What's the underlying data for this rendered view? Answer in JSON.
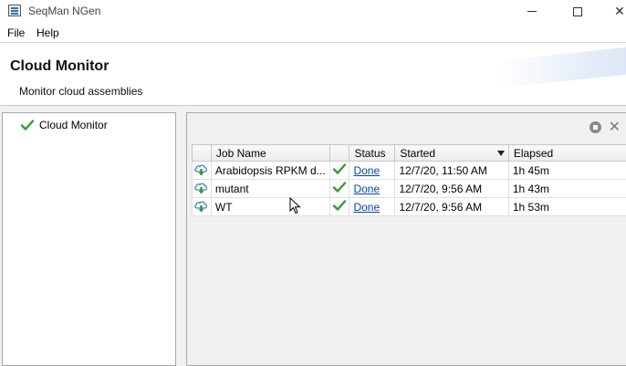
{
  "window": {
    "title": "SeqMan NGen",
    "minimize_icon": "minimize-icon",
    "maximize_icon": "maximize-icon",
    "close_icon": "close-icon",
    "close_glyph": "✕"
  },
  "menu": {
    "items": [
      {
        "label": "File"
      },
      {
        "label": "Help"
      }
    ]
  },
  "header": {
    "title": "Cloud Monitor",
    "subtitle": "Monitor cloud assemblies"
  },
  "sidebar": {
    "items": [
      {
        "label": "Cloud Monitor",
        "icon": "check-icon"
      }
    ]
  },
  "panel": {
    "tools": [
      {
        "icon": "stop-icon"
      },
      {
        "icon": "close-icon",
        "glyph": "✕"
      }
    ]
  },
  "table": {
    "columns": [
      "",
      "Job Name",
      "",
      "Status",
      "Started",
      "Elapsed"
    ],
    "sorted_column": "Started",
    "sort_direction": "descending",
    "rows": [
      {
        "icon": "cloud-download-icon",
        "job_name": "Arabidopsis RPKM d...",
        "done_icon": "check-icon",
        "status": "Done",
        "started": "12/7/20, 11:50 AM",
        "elapsed": "1h 45m"
      },
      {
        "icon": "cloud-download-icon",
        "job_name": "mutant",
        "done_icon": "check-icon",
        "status": "Done",
        "started": "12/7/20, 9:56 AM",
        "elapsed": "1h 43m"
      },
      {
        "icon": "cloud-download-icon",
        "job_name": "WT",
        "done_icon": "check-icon",
        "status": "Done",
        "started": "12/7/20, 9:56 AM",
        "elapsed": "1h 53m"
      }
    ]
  },
  "colors": {
    "check_green": "#2e9e2e",
    "link_blue": "#0645ad",
    "cloud_blue": "#3f7fc1",
    "arrow_green": "#2e9e2e"
  }
}
